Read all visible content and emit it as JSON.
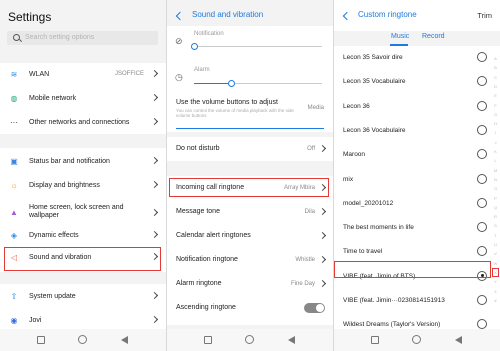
{
  "settings": {
    "title": "Settings",
    "search_placeholder": "Search setting options",
    "groups": [
      [
        {
          "icon": "wifi-icon",
          "glyph": "≋",
          "color": "#2a8be8",
          "label": "WLAN",
          "value": "JSOFFICE"
        },
        {
          "icon": "globe-icon",
          "glyph": "◍",
          "color": "#22a886",
          "label": "Mobile network",
          "value": ""
        },
        {
          "icon": "dots-icon",
          "glyph": "⋯",
          "color": "#444444",
          "label": "Other networks and connections",
          "value": ""
        }
      ],
      [
        {
          "icon": "status-bar-icon",
          "glyph": "▣",
          "color": "#3a86e0",
          "label": "Status bar and notification",
          "value": ""
        },
        {
          "icon": "brightness-icon",
          "glyph": "☼",
          "color": "#f08c28",
          "label": "Display and brightness",
          "value": ""
        },
        {
          "icon": "wallpaper-icon",
          "glyph": "👕",
          "color": "#a35ad8",
          "label": "Home screen, lock screen and wallpaper",
          "value": ""
        },
        {
          "icon": "effects-icon",
          "glyph": "◈",
          "color": "#2a8be8",
          "label": "Dynamic effects",
          "value": ""
        },
        {
          "icon": "speaker-icon",
          "glyph": "◁",
          "color": "#f05a3c",
          "label": "Sound and vibration",
          "value": ""
        }
      ],
      [
        {
          "icon": "update-icon",
          "glyph": "⇧",
          "color": "#2a8be8",
          "label": "System update",
          "value": ""
        },
        {
          "icon": "jovi-icon",
          "glyph": "◉",
          "color": "#3a6ee0",
          "label": "Jovi",
          "value": ""
        }
      ]
    ]
  },
  "sound": {
    "title": "Sound and vibration",
    "notification_label": "Notification",
    "notification_level": 0.0,
    "alarm_label": "Alarm",
    "alarm_level": 0.45,
    "volume_buttons_title": "Use the volume buttons to adjust",
    "volume_buttons_sub": "You can control the volume of media playback with the side volume buttons",
    "volume_buttons_value": "Media",
    "dnd_label": "Do not disturb",
    "dnd_value": "Off",
    "rows": [
      {
        "label": "Incoming call ringtone",
        "value": "Array Mbira"
      },
      {
        "label": "Message tone",
        "value": "Dila"
      },
      {
        "label": "Calendar alert ringtones",
        "value": ""
      },
      {
        "label": "Notification ringtone",
        "value": "Whistle"
      },
      {
        "label": "Alarm ringtone",
        "value": "Fine Day"
      },
      {
        "label": "Ascending ringtone",
        "value": ""
      }
    ]
  },
  "ringtone": {
    "title": "Custom ringtone",
    "trim": "Trim",
    "tabs": [
      "Music",
      "Record"
    ],
    "items": [
      {
        "label": "Lecon 35 Savoir dire",
        "selected": false
      },
      {
        "label": "Lecon 35 Vocabulaire",
        "selected": false
      },
      {
        "label": "Lecon 36",
        "selected": false
      },
      {
        "label": "Lecon 36 Vocabulaire",
        "selected": false
      },
      {
        "label": "Maroon",
        "selected": false
      },
      {
        "label": "mix",
        "selected": false
      },
      {
        "label": "model_20201012",
        "selected": false
      },
      {
        "label": "The best moments in life",
        "selected": false
      },
      {
        "label": "Time to travel",
        "selected": false
      },
      {
        "label": "VIBE (feat. Jimin of BTS)",
        "selected": true
      },
      {
        "label": "VIBE (feat. Jimin···0230814151913",
        "selected": false
      },
      {
        "label": "Wildest Dreams (Taylor's Version)",
        "selected": false
      }
    ],
    "alphabet": [
      "A",
      "B",
      "C",
      "D",
      "E",
      "F",
      "G",
      "H",
      "I",
      "J",
      "K",
      "L",
      "M",
      "N",
      "O",
      "P",
      "Q",
      "R",
      "S",
      "T",
      "U",
      "V",
      "W",
      "X",
      "Y",
      "Z",
      "#"
    ]
  }
}
